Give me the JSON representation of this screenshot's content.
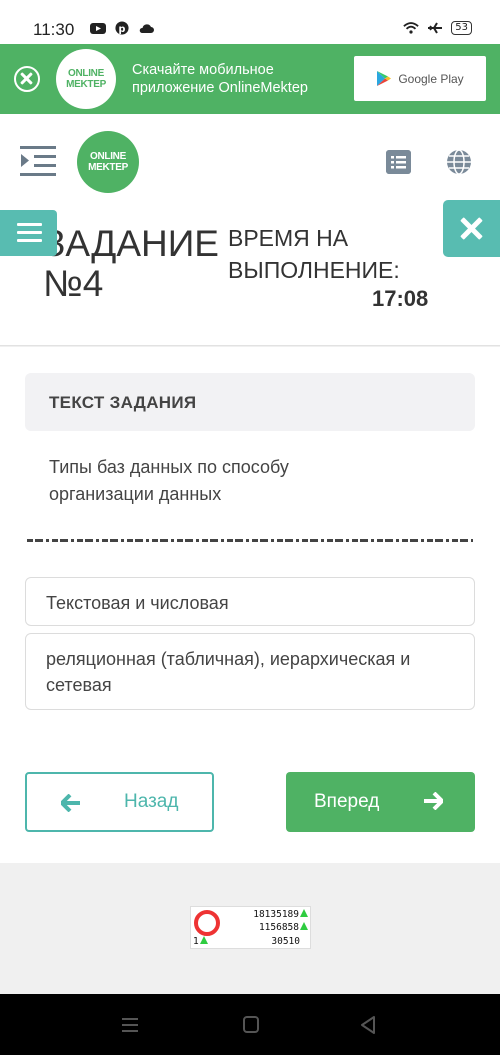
{
  "status_bar": {
    "time": "11:30",
    "battery": "53"
  },
  "promo": {
    "logo_line1": "ONLINE",
    "logo_line2": "MEKTEP",
    "text": "Скачайте мобильное приложение OnlineMektep",
    "store_label": "Google Play"
  },
  "header": {
    "logo_line1": "ONLINE",
    "logo_line2": "MEKTEP",
    "task_title_line1": "ЗАДАНИЕ",
    "task_title_line2": "№4",
    "time_label_line1": "ВРЕМЯ НА",
    "time_label_line2": "ВЫПОЛНЕНИЕ:",
    "time_value": "17:08"
  },
  "task": {
    "heading": "ТЕКСТ ЗАДАНИЯ",
    "question": "Типы баз данных по способу организации данных",
    "options": [
      "Текстовая и числовая",
      "реляционная (табличная), иерархическая и сетевая"
    ]
  },
  "nav_buttons": {
    "back": "Назад",
    "next": "Вперед"
  },
  "counter": {
    "line1": "18135189",
    "line2": "1156858",
    "line3_left": "1",
    "line3_right": "30510"
  },
  "colors": {
    "brand_green": "#4fb264",
    "teal": "#58bcb1"
  }
}
